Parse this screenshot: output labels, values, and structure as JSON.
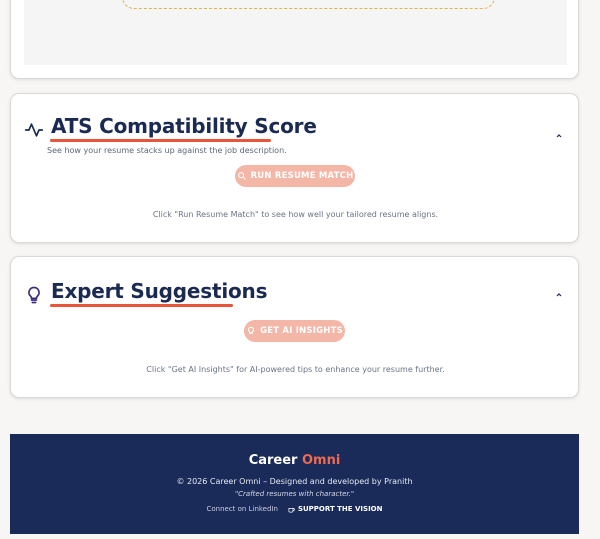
{
  "ats": {
    "title": "ATS Compatibility Score",
    "subtitle": "See how your resume stacks up against the job description.",
    "button_label": "RUN RESUME MATCH",
    "hint": "Click \"Run Resume Match\" to see how well your tailored resume aligns.",
    "icon": "activity-icon"
  },
  "expert": {
    "title": "Expert Suggestions",
    "button_label": "GET AI INSIGHTS",
    "hint": "Click \"Get AI Insights\" for AI-powered tips to enhance your resume further.",
    "icon": "lightbulb-icon"
  },
  "footer": {
    "brand_main": "Career ",
    "brand_accent": "Omni",
    "copyright": "© 2026 Career Omni – Designed and developed by Pranith",
    "tagline": "\"Crafted resumes with character.\"",
    "linkedin_label": "Connect on LinkedIn",
    "support_label": "SUPPORT THE VISION"
  },
  "colors": {
    "navy": "#1b2a52",
    "accent": "#e8553b",
    "pill": "#f4b6a6",
    "footer_bg": "#1a2a59"
  }
}
